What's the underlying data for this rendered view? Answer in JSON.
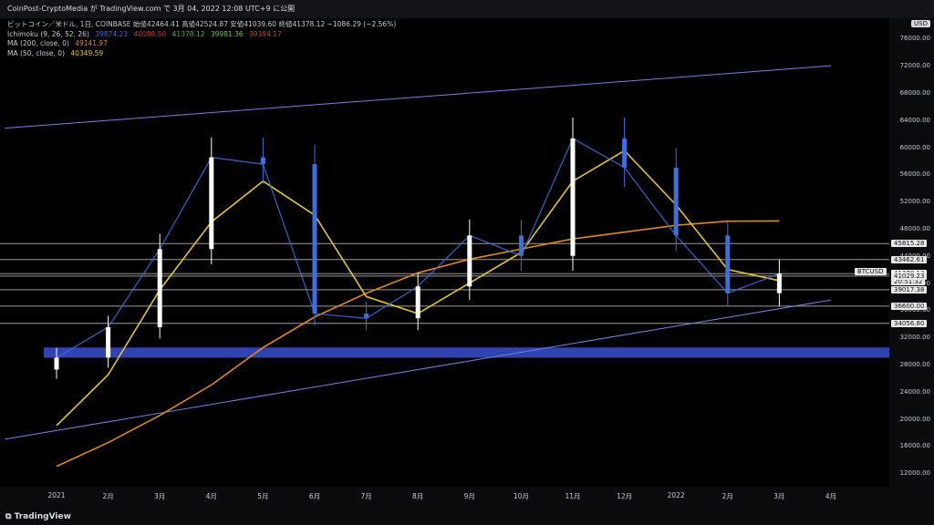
{
  "header": {
    "attribution": "CoinPost-CryptoMedia が TradingView.com で 3月 04, 2022 12:08 UTC+9 に公開"
  },
  "legend": {
    "title_line": "ビットコイン／米ドル, 1日, COINBASE  始値42464.41  高値42524.87  安値41039.60  終値41378.12  −1086.29 (−2.56%)",
    "ichimoku_label": "Ichimoku (9, 26, 52, 26)",
    "ichimoku_values": [
      "39874.23",
      "40088.50",
      "41378.12",
      "39981.36",
      "39394.17"
    ],
    "ma200_label": "MA (200, close, 0)",
    "ma200_value": "49141.97",
    "ma50_label": "MA (50, close, 0)",
    "ma50_value": "40349.59"
  },
  "colors": {
    "ichimoku": [
      "#3d6bd6",
      "#c0392b",
      "#4caf50",
      "#6fbf5f",
      "#b04a3a"
    ],
    "ma200": "#e08a1e",
    "ma50": "#e2c531",
    "candle_up": "#ffffff",
    "candle_down": "#3e6fe0",
    "channel": "#6f86e0",
    "band": "#3a4fcf"
  },
  "axis": {
    "currency": "USD",
    "ticker_tag": "BTCUSD",
    "price_levels": [
      "76000.00",
      "72000.00",
      "68000.00",
      "64000.00",
      "60000.00",
      "56000.00",
      "52000.00",
      "48000.00",
      "44000.00",
      "40000.00",
      "36000.00",
      "32000.00",
      "28000.00",
      "24000.00",
      "20000.00",
      "16000.00",
      "12000.00"
    ],
    "tags": [
      "45815.28",
      "43462.61",
      "41378.12",
      "20:51:32",
      "41029.23",
      "39017.38",
      "36600.00",
      "34056.80"
    ],
    "months": [
      "2021",
      "2月",
      "3月",
      "4月",
      "5月",
      "6月",
      "7月",
      "8月",
      "9月",
      "10月",
      "11月",
      "12月",
      "2022",
      "2月",
      "3月",
      "4月"
    ]
  },
  "footer": {
    "brand": "TradingView"
  },
  "chart_data": {
    "type": "line",
    "title": "ビットコイン／米ドル, 1日, COINBASE",
    "xlabel": "",
    "ylabel": "",
    "ylim": [
      10000,
      79000
    ],
    "grid": false,
    "x": [
      "2021-01",
      "2021-02",
      "2021-03",
      "2021-04",
      "2021-05",
      "2021-06",
      "2021-07",
      "2021-08",
      "2021-09",
      "2021-10",
      "2021-11",
      "2021-12",
      "2022-01",
      "2022-02",
      "2022-03"
    ],
    "series": [
      {
        "name": "BTCUSD",
        "values": [
          29000,
          33500,
          45000,
          58500,
          57500,
          35500,
          34800,
          39500,
          47000,
          44000,
          61300,
          57000,
          47000,
          38500,
          41378
        ]
      },
      {
        "name": "MA (200, close, 0)",
        "values": [
          13000,
          16500,
          20500,
          25000,
          30500,
          35000,
          38500,
          41500,
          43500,
          45000,
          46500,
          47500,
          48500,
          49100,
          49142
        ]
      },
      {
        "name": "MA (50, close, 0)",
        "values": [
          19000,
          26500,
          39000,
          49000,
          55000,
          50000,
          38000,
          35500,
          40000,
          44500,
          55000,
          59500,
          51500,
          42000,
          40350
        ]
      }
    ],
    "horizontal_levels": [
      45815.28,
      43462.61,
      41378.12,
      41029.23,
      39017.38,
      36600.0,
      34056.8
    ],
    "support_band": [
      29000,
      30500
    ],
    "trend_channel": {
      "upper": {
        "from": [
          "2020-12",
          62800
        ],
        "to": [
          "2022-04",
          72000
        ]
      },
      "lower": {
        "from": [
          "2020-12",
          17000
        ],
        "to": [
          "2022-04",
          37500
        ]
      }
    }
  }
}
